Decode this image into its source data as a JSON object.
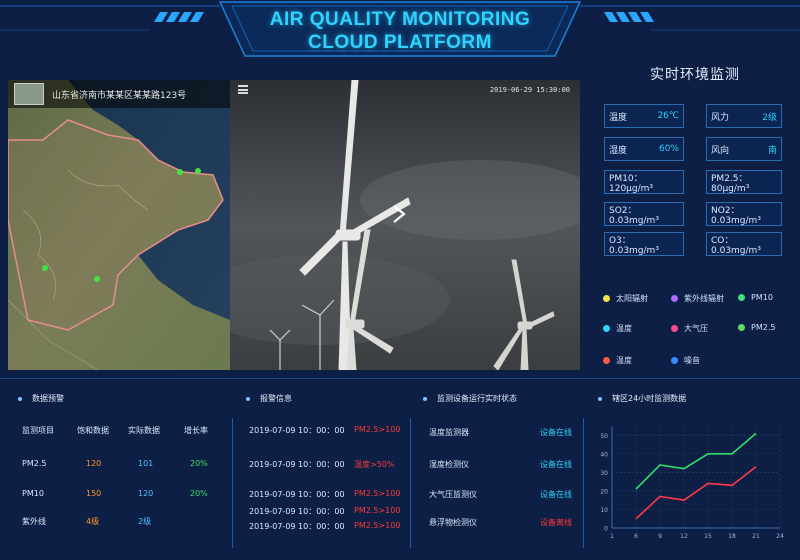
{
  "header": {
    "title_line1": "AIR QUALITY MONITORING",
    "title_line2": "CLOUD PLATFORM"
  },
  "map": {
    "address": "山东省济南市某某区某某路123号"
  },
  "video": {
    "timestamp": "2019-06-29 15:30:00",
    "menu_icon": "menu-icon",
    "play_icon": "play-icon"
  },
  "environment": {
    "title": "实时环境监测",
    "readings": [
      {
        "label": "温度",
        "value": "26℃"
      },
      {
        "label": "风力",
        "value": "2级"
      },
      {
        "label": "湿度",
        "value": "60%"
      },
      {
        "label": "风向",
        "value": "南"
      }
    ],
    "concentrations": [
      "PM10：120μg/m³",
      "PM2.5：80μg/m³",
      "SO2：0.03mg/m³",
      "NO2：0.03mg/m³",
      "O3：0.03mg/m³",
      "CO：0.03mg/m³"
    ],
    "legend": [
      {
        "label": "太阳辐射",
        "color": "#f6e24a"
      },
      {
        "label": "紫外线辐射",
        "color": "#b06bff"
      },
      {
        "label": "PM10",
        "color": "#3ee07a"
      },
      {
        "label": "温度",
        "color": "#2fd3ff"
      },
      {
        "label": "大气压",
        "color": "#ff4a8a"
      },
      {
        "label": "PM2.5",
        "color": "#5fdc5f"
      },
      {
        "label": "温度",
        "color": "#ff5a3a"
      },
      {
        "label": "噪音",
        "color": "#3a8aff"
      }
    ]
  },
  "alarm_data": {
    "title": "数据预警",
    "headers": [
      "监测项目",
      "饱和数据",
      "实际数据",
      "增长率"
    ],
    "rows": [
      [
        "PM2.5",
        "120",
        "101",
        "20%"
      ],
      [
        "PM10",
        "150",
        "120",
        "20%"
      ],
      [
        "紫外线",
        "4级",
        "2级",
        ""
      ]
    ]
  },
  "alarm_info": {
    "title": "报警信息",
    "rows": [
      {
        "time": "2019-07-09  10：00：00",
        "msg": "PM2.5>100"
      },
      {
        "time": "2019-07-09  10：00：00",
        "msg": "温度>50%"
      },
      {
        "time": "2019-07-09  10：00：00",
        "msg": "PM2.5>100"
      },
      {
        "time": "2019-07-09  10：00：00",
        "msg": "PM2.5>100"
      },
      {
        "time": "2019-07-09  10：00：00",
        "msg": "PM2.5>100"
      }
    ]
  },
  "device_status": {
    "title": "监测设备运行实时状态",
    "rows": [
      {
        "name": "温度监测器",
        "status": "设备在线",
        "online": true
      },
      {
        "name": "湿度检测仪",
        "status": "设备在线",
        "online": true
      },
      {
        "name": "大气压监测仪",
        "status": "设备在线",
        "online": true
      },
      {
        "name": "悬浮物检测仪",
        "status": "设备离线",
        "online": false
      }
    ]
  },
  "chart_data": {
    "type": "line",
    "title": "辖区24小时监测数据",
    "x": [
      1,
      6,
      9,
      12,
      15,
      18,
      21,
      24
    ],
    "x_ticks": [
      1,
      6,
      9,
      12,
      15,
      18,
      21,
      24
    ],
    "y_ticks": [
      0,
      10,
      20,
      30,
      40,
      50
    ],
    "ylim": [
      0,
      55
    ],
    "grid": true,
    "series": [
      {
        "color": "#2ee06a",
        "values": [
          21,
          34,
          32,
          40,
          40,
          51
        ]
      },
      {
        "color": "#ff3a4a",
        "values": [
          5,
          17,
          15,
          24,
          23,
          33
        ]
      }
    ],
    "series_x": [
      1,
      6,
      9,
      12,
      15,
      18,
      21,
      24
    ]
  }
}
